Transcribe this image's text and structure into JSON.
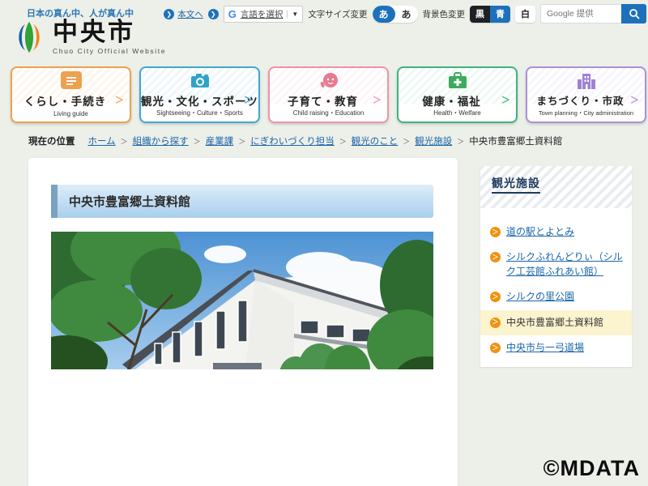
{
  "ui": {
    "chevron": "＞",
    "caret": "▼",
    "arrow": "❯",
    "separator": "＞"
  },
  "header": {
    "tagline": "日本の真ん中、人が真ん中",
    "site_name": "中央市",
    "site_subtitle": "Chuo City Official Website",
    "skip_link": "本文へ",
    "google_g": "G",
    "language_label": "言語を選択",
    "text_size_label": "文字サイズ変更",
    "text_size_small": "あ",
    "text_size_large": "あ",
    "bg_color_label": "背景色変更",
    "bg_black": "黒",
    "bg_blue": "青",
    "bg_white": "白",
    "search_placeholder": "Google 提供",
    "accent_blue": "#1d71bb"
  },
  "nav_cards": [
    {
      "jp": "くらし・手続き",
      "en": "Living guide",
      "color": "#eda14e",
      "icon": "memo-icon"
    },
    {
      "jp": "観光・文化・スポーツ",
      "en": "Sightseeing・Culture・Sports",
      "color": "#3fa9cf",
      "icon": "camera-icon"
    },
    {
      "jp": "子育て・教育",
      "en": "Child raising・Education",
      "color": "#ef93a8",
      "icon": "baby-icon"
    },
    {
      "jp": "健康・福祉",
      "en": "Health・Welfare",
      "color": "#3eb37f",
      "icon": "first-aid-icon"
    },
    {
      "jp": "まちづくり・市政",
      "en": "Town planning・City administration",
      "color": "#ab90d8",
      "icon": "building-icon"
    }
  ],
  "breadcrumb": {
    "label": "現在の位置",
    "items": [
      {
        "label": "ホーム"
      },
      {
        "label": "組織から探す"
      },
      {
        "label": "産業課"
      },
      {
        "label": "にぎわいづくり担当"
      },
      {
        "label": "観光のこと"
      },
      {
        "label": "観光施設"
      },
      {
        "label": "中央市豊富郷土資料館"
      }
    ]
  },
  "main": {
    "page_title": "中央市豊富郷土資料館"
  },
  "sidebar": {
    "title": "観光施設",
    "links": [
      {
        "label": "道の駅とよとみ"
      },
      {
        "label": "シルクふれんどりぃ（シルク工芸館ふれあい館）"
      },
      {
        "label": "シルクの里公園"
      },
      {
        "label": "中央市豊富郷土資料館"
      },
      {
        "label": "中央市与一弓道場"
      }
    ],
    "current_index": 3,
    "link_icon_color": "#f0920f"
  },
  "page": {
    "watermark": "©MDATA"
  }
}
